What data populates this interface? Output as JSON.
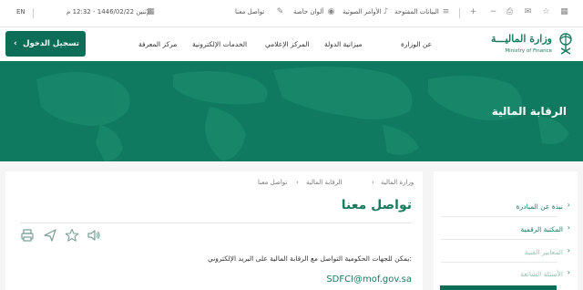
{
  "topbar": {
    "lang": "EN",
    "datetime": "الإثنين 1446/02/22 - 12:32 م",
    "contact": "تواصل معنا",
    "special_colors": "ألوان خاصة",
    "voice_commands": "الأوامر الصوتية",
    "open_data": "البيانات المفتوحة"
  },
  "header": {
    "login_label": "تسجيل الدخول",
    "nav": [
      "مركز المعرفة",
      "الخدمات الإلكترونية",
      "المركز الإعلامي",
      "ميزانية الدولة",
      "عن الوزارة"
    ],
    "logo_ar": "وزارة الماليـــة",
    "logo_en": "Ministry of Finance"
  },
  "banner": {
    "title": "الرقابة المالية"
  },
  "breadcrumb": {
    "home": "وزارة المالية",
    "section": "الرقابة المالية",
    "current": "تواصل معنا"
  },
  "main": {
    "title": "تواصل معنا",
    "body": "يمكن للجهات الحكومية التواصل مع الرقابة المالية على البريد الإلكتروني:",
    "email": "SDFCI@mof.gov.sa"
  },
  "sidebar": {
    "items": [
      {
        "label": "نبذة عن المبادرة"
      },
      {
        "label": "المكتبة الرقمية"
      },
      {
        "label": "المعايير الفنية"
      },
      {
        "label": "الأسئلة الشائعة"
      }
    ]
  },
  "colors": {
    "brand": "#0d6e57",
    "banner": "#0f7a5f",
    "accent_text": "#1a7a5e"
  }
}
